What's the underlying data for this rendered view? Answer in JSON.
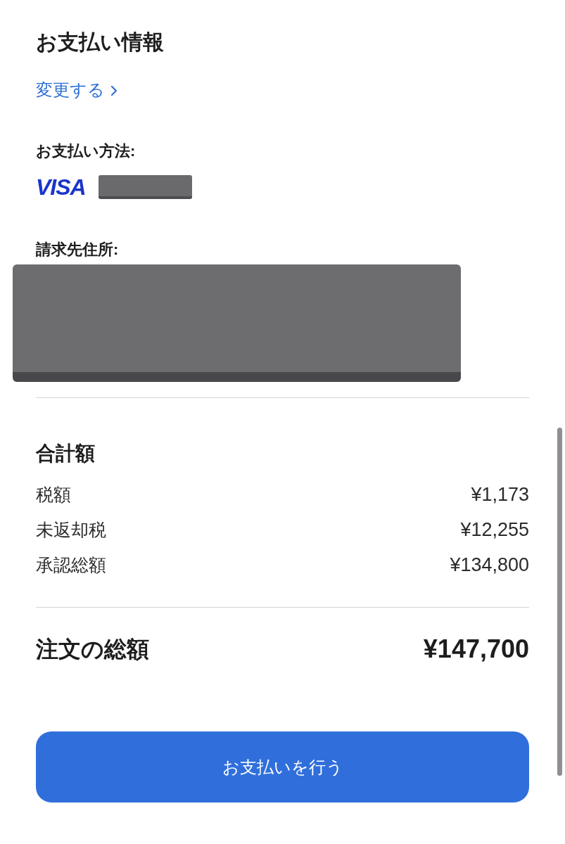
{
  "section_title": "お支払い情報",
  "change_link": {
    "label": "変更する"
  },
  "payment_method": {
    "label": "お支払い方法:",
    "card_brand": "VISA"
  },
  "billing_address": {
    "label": "請求先住所:"
  },
  "totals": {
    "title": "合計額",
    "rows": [
      {
        "label": "税額",
        "value": "¥1,173"
      },
      {
        "label": "未返却税",
        "value": "¥12,255"
      },
      {
        "label": "承認総額",
        "value": "¥134,800"
      }
    ]
  },
  "order_total": {
    "label": "注文の総額",
    "value": "¥147,700"
  },
  "pay_button": {
    "label": "お支払いを行う"
  }
}
